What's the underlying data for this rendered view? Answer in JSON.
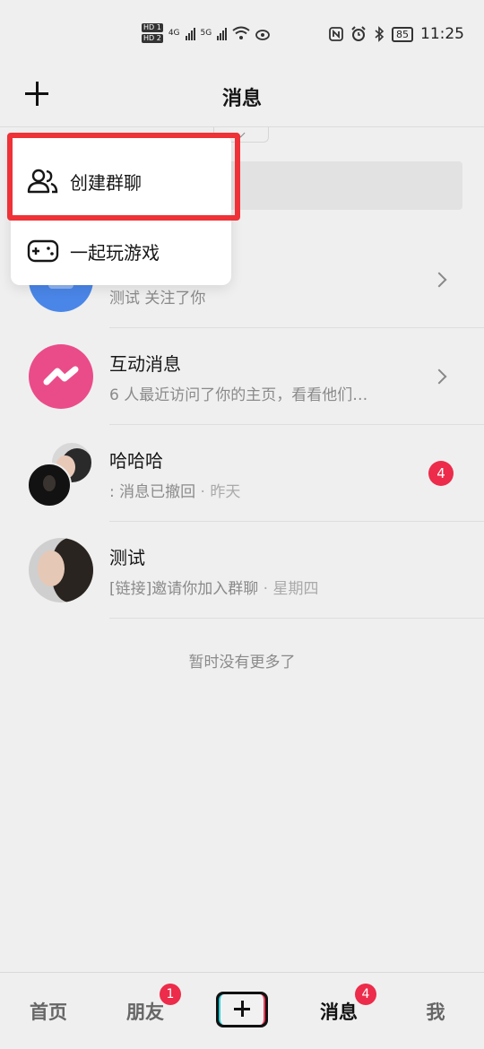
{
  "status_bar": {
    "hd1": "HD 1",
    "hd2": "HD 2",
    "net1": "4G",
    "net2": "5G",
    "battery": "85",
    "time": "11:25"
  },
  "header": {
    "title": "消息"
  },
  "popup_menu": {
    "items": [
      {
        "label": "创建群聊",
        "icon": "group-users-icon"
      },
      {
        "label": "一起玩游戏",
        "icon": "gamepad-icon"
      }
    ]
  },
  "messages": [
    {
      "title": "",
      "subtitle": "测试 关注了你",
      "time": "",
      "chevron": true,
      "avatar_color": "#4a86e8"
    },
    {
      "title": "互动消息",
      "subtitle": "6 人最近访问了你的主页，看看他们…",
      "time": "",
      "chevron": true,
      "avatar_color": "#ea4c89"
    },
    {
      "title": "哈哈哈",
      "subtitle": ": 消息已撤回",
      "time": "· 昨天",
      "badge": "4"
    },
    {
      "title": "测试",
      "subtitle": "[链接]邀请你加入群聊",
      "time": "· 星期四"
    }
  ],
  "footer_text": "暂时没有更多了",
  "bottom_nav": {
    "home": "首页",
    "friends": "朋友",
    "friends_badge": "1",
    "messages": "消息",
    "messages_badge": "4",
    "me": "我"
  },
  "colors": {
    "highlight": "#ee3237",
    "badge": "#ec2c4a"
  }
}
